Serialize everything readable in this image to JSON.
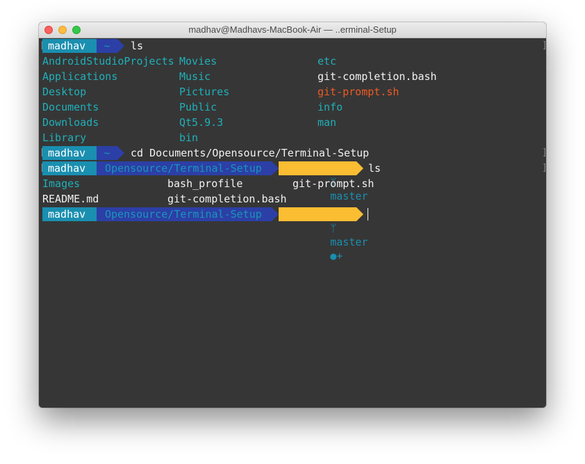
{
  "window": {
    "title": "madhav@Madhavs-MacBook-Air — ..erminal-Setup"
  },
  "colors": {
    "user_bg": "#1a8fb0",
    "dir_bg": "#2c3fa6",
    "git_bg": "#fbbd32",
    "teal_text": "#1fb0b9",
    "orange_text": "#ec5b24",
    "background": "#363636"
  },
  "prompts": [
    {
      "user": "madhav",
      "dir": "~",
      "command": "ls"
    },
    {
      "user": "madhav",
      "dir": "~",
      "command": "cd Documents/Opensource/Terminal-Setup"
    },
    {
      "user": "madhav",
      "dir": "Opensource/Terminal-Setup",
      "git_icon": "ᛘ",
      "branch": "master",
      "git_status": "●+",
      "command": "ls"
    },
    {
      "user": "madhav",
      "dir": "Opensource/Terminal-Setup",
      "git_icon": "ᛘ",
      "branch": "master",
      "git_status": "●+",
      "command": ""
    }
  ],
  "ls_home": [
    {
      "name": "AndroidStudioProjects",
      "kind": "dir"
    },
    {
      "name": "Movies",
      "kind": "dir"
    },
    {
      "name": "etc",
      "kind": "dir"
    },
    {
      "name": "Applications",
      "kind": "dir"
    },
    {
      "name": "Music",
      "kind": "dir"
    },
    {
      "name": "git-completion.bash",
      "kind": "file"
    },
    {
      "name": "Desktop",
      "kind": "dir"
    },
    {
      "name": "Pictures",
      "kind": "dir"
    },
    {
      "name": "git-prompt.sh",
      "kind": "exec"
    },
    {
      "name": "Documents",
      "kind": "dir"
    },
    {
      "name": "Public",
      "kind": "dir"
    },
    {
      "name": "info",
      "kind": "dir"
    },
    {
      "name": "Downloads",
      "kind": "dir"
    },
    {
      "name": "Qt5.9.3",
      "kind": "dir"
    },
    {
      "name": "man",
      "kind": "dir"
    },
    {
      "name": "Library",
      "kind": "dir"
    },
    {
      "name": "bin",
      "kind": "dir"
    }
  ],
  "ls_setup": [
    {
      "name": "Images",
      "kind": "dir"
    },
    {
      "name": "bash_profile",
      "kind": "file"
    },
    {
      "name": "git-prompt.sh",
      "kind": "file"
    },
    {
      "name": "README.md",
      "kind": "file"
    },
    {
      "name": "git-completion.bash",
      "kind": "file"
    }
  ]
}
